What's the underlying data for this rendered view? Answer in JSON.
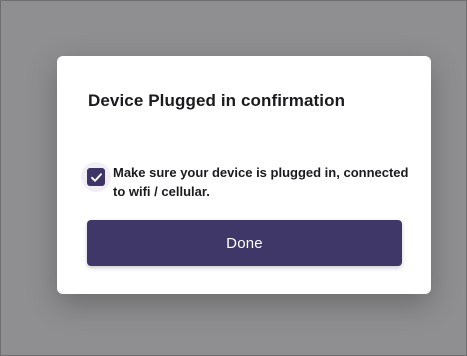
{
  "modal": {
    "title": "Device Plugged in confirmation",
    "checkbox": {
      "checked": true,
      "label": "Make sure your device is plugged in, connected to wifi / cellular.",
      "icon": "checkmark-icon"
    },
    "done_label": "Done"
  },
  "colors": {
    "backdrop": "#8f8f91",
    "accent": "#3f3767",
    "surface": "#ffffff",
    "text": "#1b1b1f"
  }
}
